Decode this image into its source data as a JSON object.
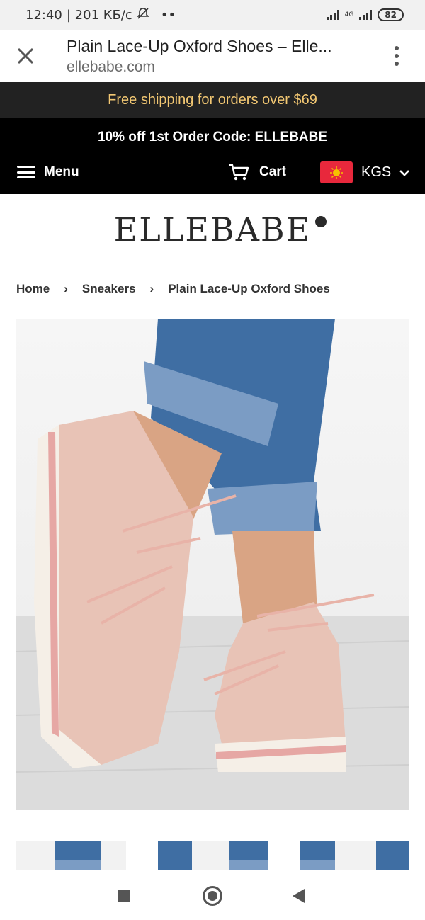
{
  "status_bar": {
    "time": "12:40",
    "network_speed": "| 201 КБ/с",
    "dots": "••",
    "network_type": "4G",
    "battery": "82"
  },
  "browser": {
    "title": "Plain Lace-Up Oxford Shoes – Elle...",
    "domain": "ellebabe.com"
  },
  "promo": {
    "shipping": "Free shipping for orders over $69",
    "discount": "10% off 1st Order Code: ELLEBABE"
  },
  "nav": {
    "menu_label": "Menu",
    "cart_label": "Cart",
    "currency": "KGS"
  },
  "logo": {
    "text": "ELLEBABE"
  },
  "breadcrumb": {
    "items": [
      "Home",
      "Sneakers",
      "Plain Lace-Up Oxford Shoes"
    ],
    "separator": "›"
  },
  "colors": {
    "promo_text": "#f3c873",
    "flag": "#e8283c",
    "shoe": "#e8c3b6",
    "denim": "#3f6ea3"
  }
}
